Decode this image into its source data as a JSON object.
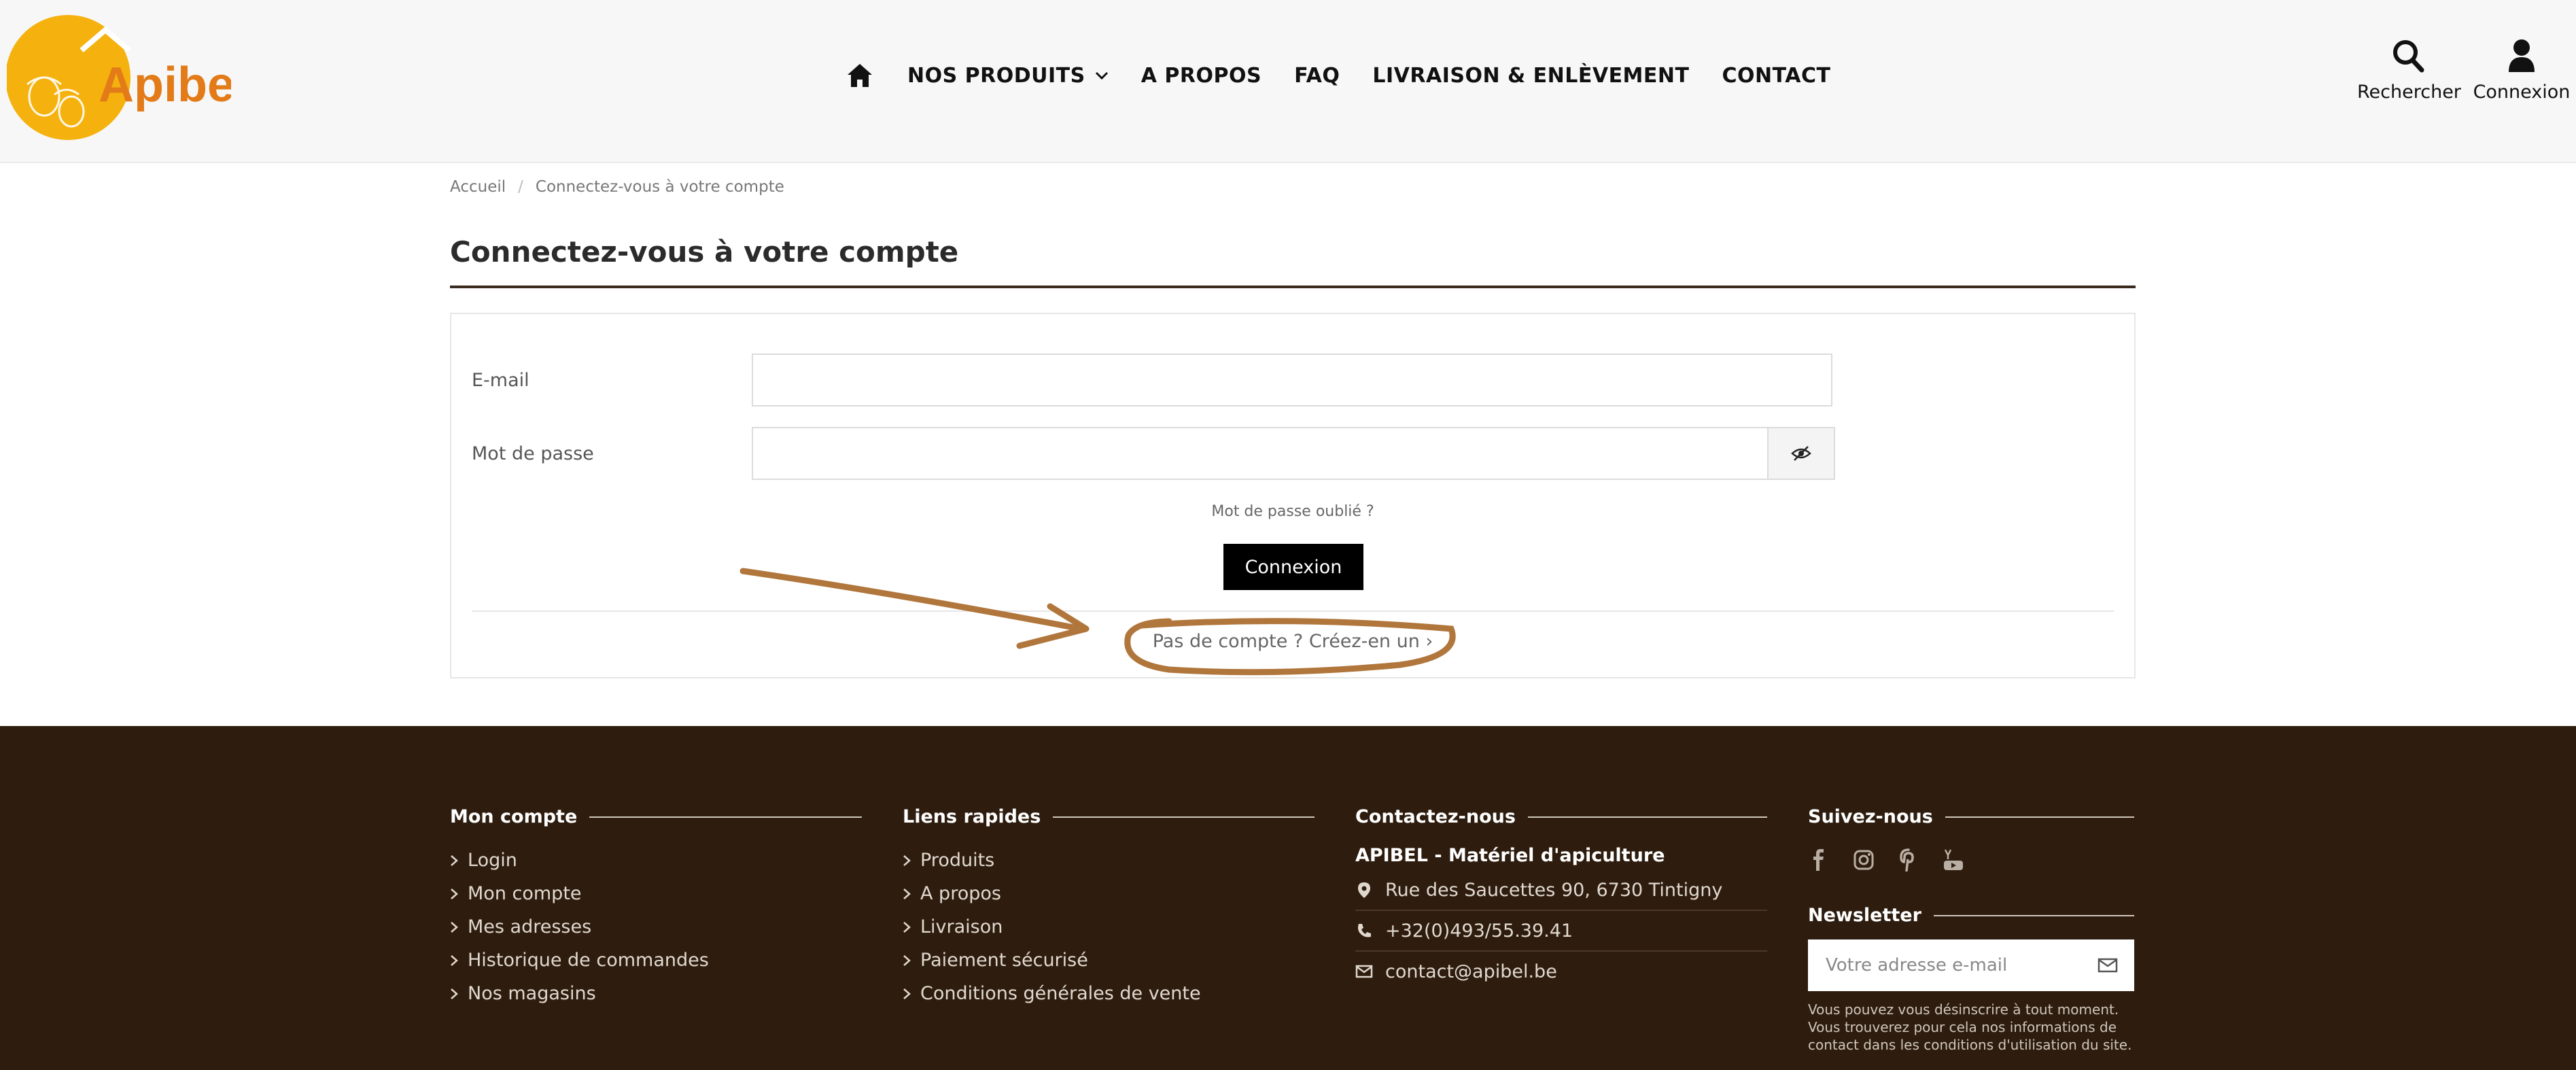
{
  "header": {
    "brand": "Apibel",
    "nav": [
      "NOS PRODUITS",
      "A PROPOS",
      "FAQ",
      "LIVRAISON & ENLÈVEMENT",
      "CONTACT"
    ],
    "search_label": "Rechercher",
    "login_label": "Connexion"
  },
  "breadcrumb": {
    "home": "Accueil",
    "separator": "/",
    "current": "Connectez-vous à votre compte"
  },
  "page": {
    "title": "Connectez-vous à votre compte"
  },
  "login_form": {
    "email_label": "E-mail",
    "email_value": "",
    "password_label": "Mot de passe",
    "password_value": "",
    "forgot_label": "Mot de passe oublié ?",
    "submit_label": "Connexion",
    "create_account_label": "Pas de compte ? Créez-en un"
  },
  "footer": {
    "account": {
      "heading": "Mon compte",
      "links": [
        "Login",
        "Mon compte",
        "Mes adresses",
        "Historique de commandes",
        "Nos magasins"
      ]
    },
    "quick_links": {
      "heading": "Liens rapides",
      "links": [
        "Produits",
        "A propos",
        "Livraison",
        "Paiement sécurisé",
        "Conditions générales de vente"
      ]
    },
    "contact": {
      "heading": "Contactez-nous",
      "company": "APIBEL - Matériel d'apiculture",
      "address": "Rue des Saucettes 90, 6730 Tintigny",
      "phone": "+32(0)493/55.39.41",
      "email": "contact@apibel.be"
    },
    "follow": {
      "heading": "Suivez-nous",
      "icons": [
        "facebook-icon",
        "instagram-icon",
        "pinterest-icon",
        "youtube-icon"
      ]
    },
    "newsletter": {
      "heading": "Newsletter",
      "placeholder": "Votre adresse e-mail",
      "note": "Vous pouvez vous désinscrire à tout moment. Vous trouverez pour cela nos informations de contact dans les conditions d'utilisation du site."
    }
  },
  "colors": {
    "header_bg": "#f7f7f7",
    "footer_bg": "#2e1d0f",
    "brand_yellow": "#f5b10d",
    "brand_orange": "#e37b19",
    "annotation": "#b0763b"
  }
}
